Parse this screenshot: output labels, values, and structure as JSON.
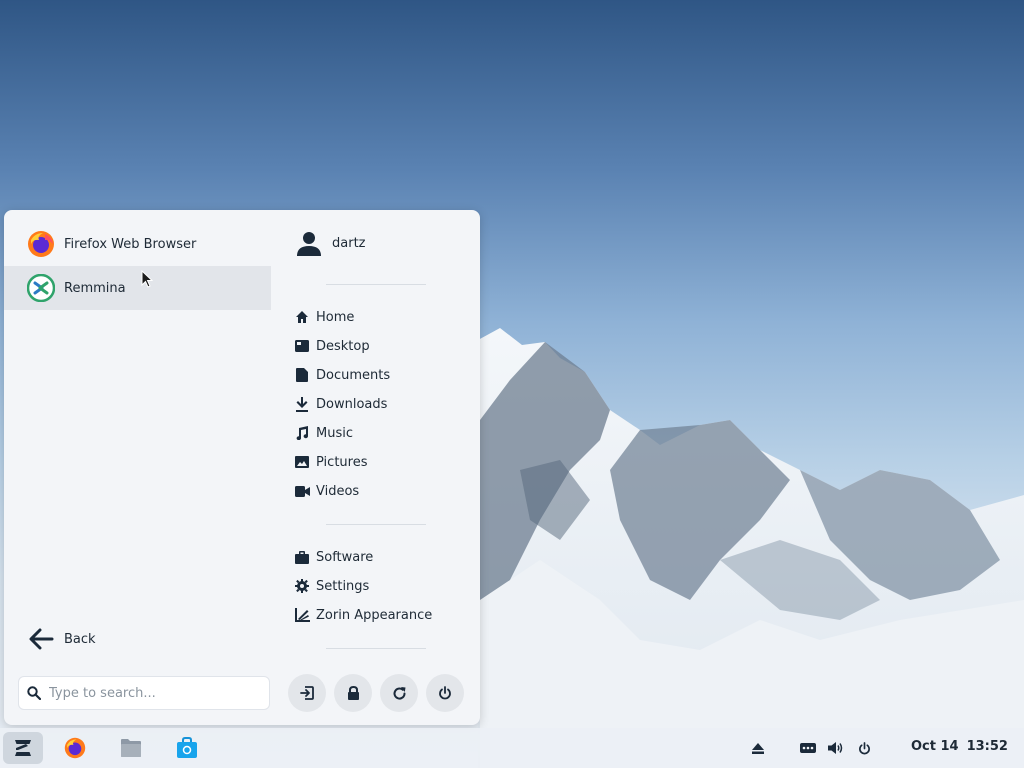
{
  "menu": {
    "apps": [
      {
        "label": "Firefox Web Browser",
        "icon": "firefox-icon"
      },
      {
        "label": "Remmina",
        "icon": "remmina-icon",
        "selected": true
      }
    ],
    "user": {
      "name": "dartz",
      "icon": "user-icon"
    },
    "places": [
      {
        "label": "Home",
        "icon": "home-icon"
      },
      {
        "label": "Desktop",
        "icon": "desktop-icon"
      },
      {
        "label": "Documents",
        "icon": "document-icon"
      },
      {
        "label": "Downloads",
        "icon": "download-icon"
      },
      {
        "label": "Music",
        "icon": "music-icon"
      },
      {
        "label": "Pictures",
        "icon": "picture-icon"
      },
      {
        "label": "Videos",
        "icon": "video-icon"
      }
    ],
    "system": [
      {
        "label": "Software",
        "icon": "software-icon"
      },
      {
        "label": "Settings",
        "icon": "settings-gear-icon"
      },
      {
        "label": "Zorin Appearance",
        "icon": "appearance-icon"
      }
    ],
    "back_label": "Back",
    "search": {
      "placeholder": "Type to search...",
      "value": ""
    },
    "power_buttons": [
      "log-out-icon",
      "lock-icon",
      "restart-icon",
      "power-icon"
    ]
  },
  "taskbar": {
    "apps": [
      "zorin-menu-icon",
      "firefox-icon",
      "files-icon",
      "software-store-icon"
    ],
    "tray": [
      "eject-icon",
      "network-icon",
      "volume-icon",
      "power-icon"
    ],
    "date": "Oct 14",
    "time": "13:52"
  },
  "colors": {
    "menu_bg": "#f3f5f8",
    "selected_bg": "#e2e5ea",
    "text": "#1e2a36",
    "icon_dark": "#1b2a3a",
    "remmina_green": "#2fa36b",
    "remmina_blue": "#2c7bc4"
  }
}
